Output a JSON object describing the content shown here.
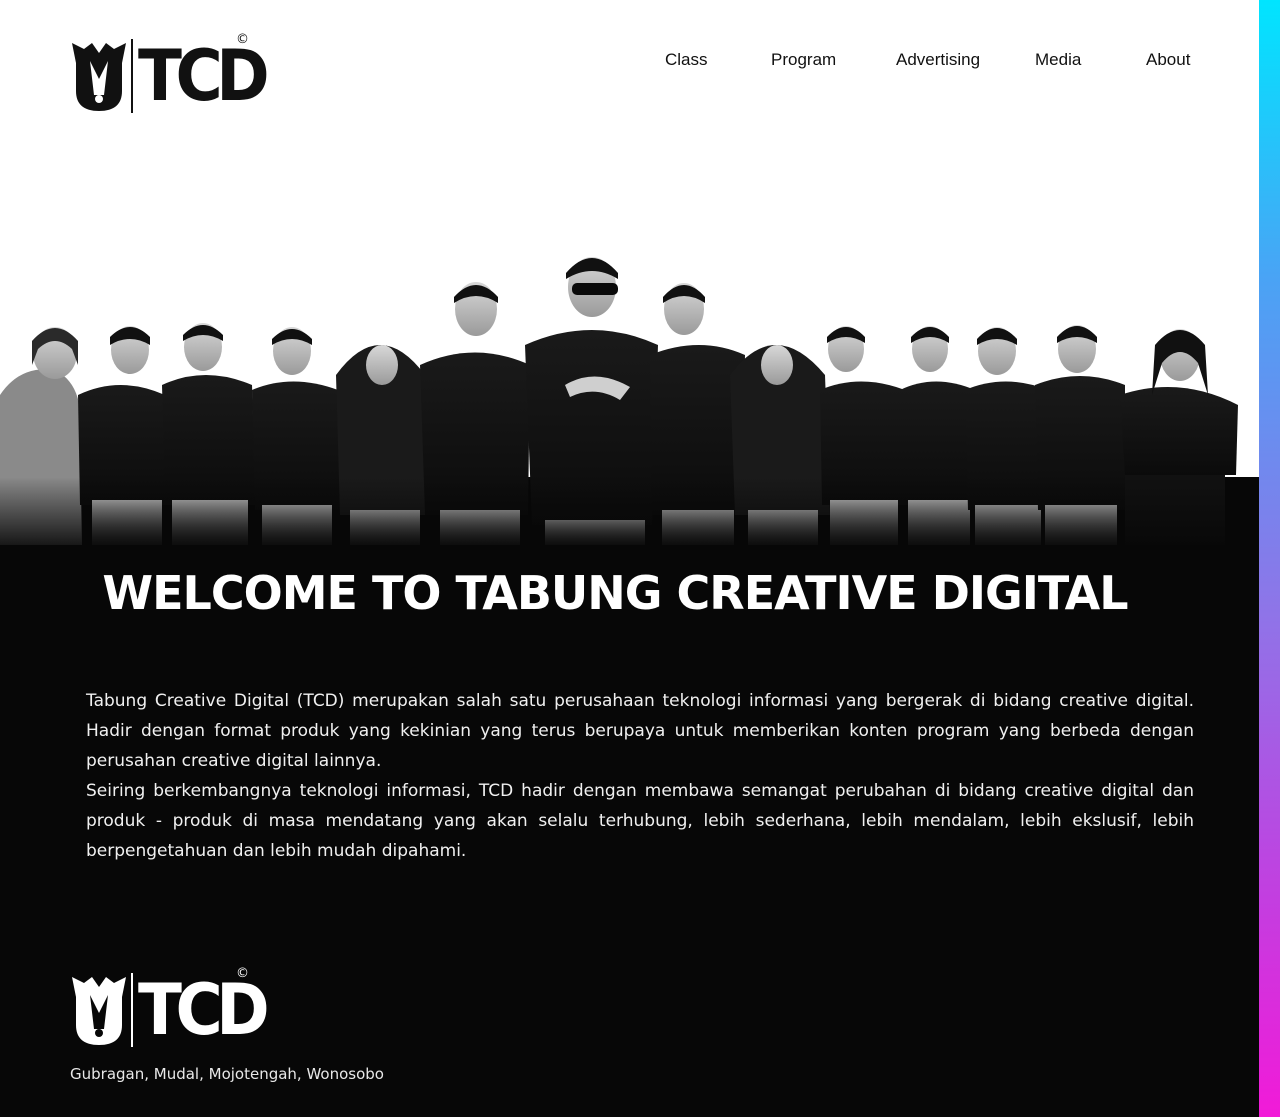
{
  "brand": {
    "name": "TCD",
    "copyright_mark": "©"
  },
  "nav": {
    "items": [
      {
        "label": "Class"
      },
      {
        "label": "Program"
      },
      {
        "label": "Advertising"
      },
      {
        "label": "Media"
      },
      {
        "label": "About"
      }
    ]
  },
  "hero": {
    "title": "WELCOME TO TABUNG CREATIVE DIGITAL",
    "paragraphs": [
      "Tabung Creative Digital (TCD) merupakan salah satu perusahaan teknologi informasi yang bergerak di bidang creative digital. Hadir dengan format produk yang kekinian yang terus berupaya untuk memberikan konten program yang berbeda dengan perusahan creative digital lainnya.",
      "Seiring berkembangnya teknologi informasi, TCD hadir dengan membawa semangat perubahan di bidang creative digital dan produk - produk di masa mendatang yang akan selalu terhubung, lebih sederhana, lebih mendalam, lebih ekslusif, lebih berpengetahuan dan lebih mudah dipahami."
    ]
  },
  "footer": {
    "address": "Gubragan, Mudal, Mojotengah, Wonosobo"
  },
  "colors": {
    "dark_bg": "#070707",
    "gradient_top": "#00e5ff",
    "gradient_bottom": "#f21ad8"
  },
  "icons": {
    "logo_emblem": "wolf-emblem-icon"
  }
}
